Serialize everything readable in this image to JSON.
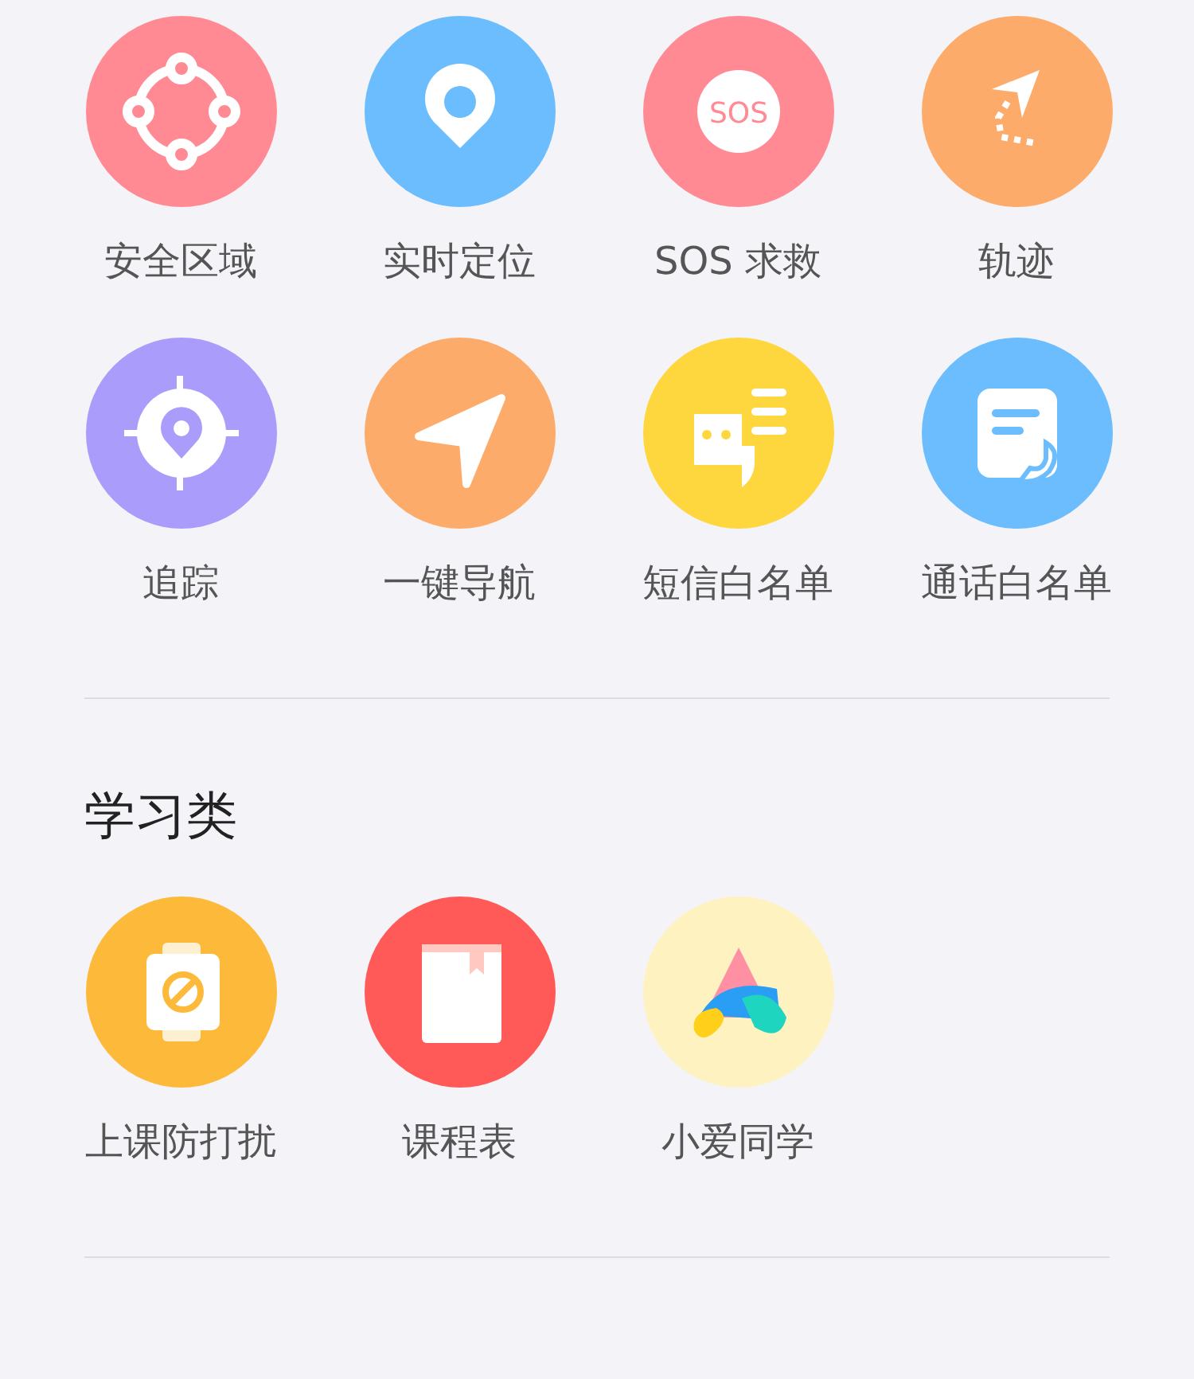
{
  "sections": [
    {
      "items": [
        {
          "label": "安全区域",
          "kind": "area",
          "color": "#ff8a93"
        },
        {
          "label": "实时定位",
          "kind": "pin",
          "color": "#6cbdfd"
        },
        {
          "label": "SOS 求救",
          "kind": "sos",
          "icon_text": "SOS",
          "color": "#ff8a93"
        },
        {
          "label": "轨迹",
          "kind": "track",
          "color": "#fdab6b"
        },
        {
          "label": "追踪",
          "kind": "target",
          "color": "#a99cfb"
        },
        {
          "label": "一键导航",
          "kind": "nav",
          "color": "#fdab6b"
        },
        {
          "label": "短信白名单",
          "kind": "sms",
          "color": "#fed73f"
        },
        {
          "label": "通话白名单",
          "kind": "call",
          "color": "#6cbdfd"
        }
      ]
    },
    {
      "title": "学习类",
      "items": [
        {
          "label": "上课防打扰",
          "kind": "watch",
          "color": "#fdb93a"
        },
        {
          "label": "课程表",
          "kind": "book",
          "color": "#ff5a57"
        },
        {
          "label": "小爱同学",
          "kind": "assistant",
          "color": "#fef2c0"
        }
      ]
    }
  ]
}
